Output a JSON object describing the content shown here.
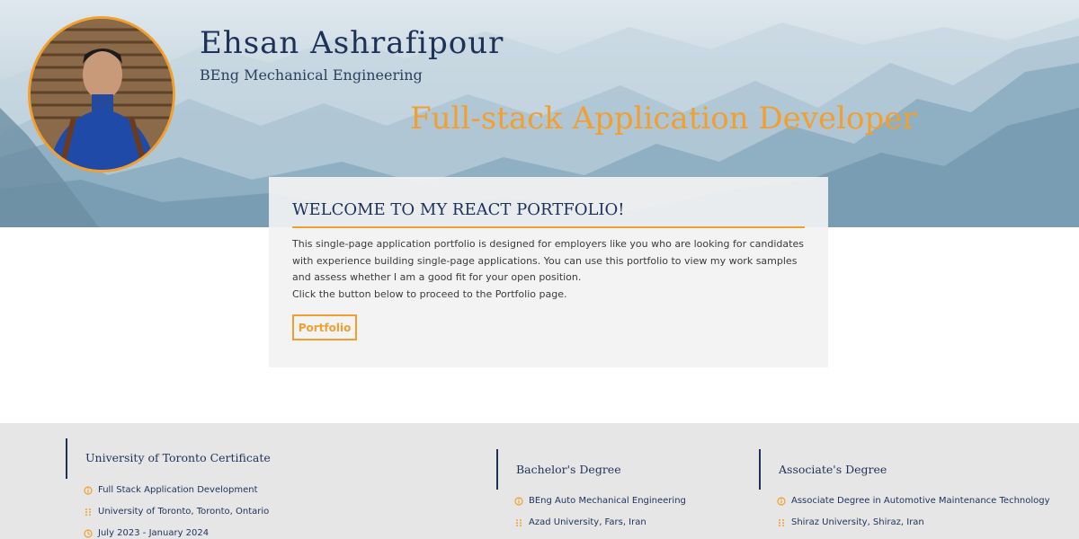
{
  "header": {
    "name": "Ehsan Ashrafipour",
    "degree": "BEng Mechanical Engineering",
    "role": "Full-stack Application Developer"
  },
  "welcome": {
    "title": "WELCOME TO MY REACT PORTFOLIO!",
    "paragraph1": "This single-page application portfolio is designed for employers like you who are looking for candidates with experience building single-page applications. You can use this portfolio to view my work samples and assess whether I am a good fit for your open position.",
    "paragraph2": "Click the button below to proceed to the Portfolio page.",
    "button_label": "Portfolio"
  },
  "education": [
    {
      "title": "University of Toronto Certificate",
      "items": [
        {
          "icon": "info-circle-icon",
          "text": "Full Stack Application Development"
        },
        {
          "icon": "location-dots-icon",
          "text": "University of Toronto, Toronto, Ontario"
        },
        {
          "icon": "clock-icon",
          "text": "July 2023 - January 2024"
        }
      ]
    },
    {
      "title": "Bachelor's Degree",
      "items": [
        {
          "icon": "info-circle-icon",
          "text": "BEng Auto Mechanical Engineering"
        },
        {
          "icon": "location-dots-icon",
          "text": "Azad University, Fars, Iran"
        }
      ]
    },
    {
      "title": "Associate's Degree",
      "items": [
        {
          "icon": "info-circle-icon",
          "text": "Associate Degree in Automotive Maintenance Technology"
        },
        {
          "icon": "location-dots-icon",
          "text": "Shiraz University, Shiraz, Iran"
        }
      ]
    }
  ],
  "colors": {
    "accent": "#f0a030",
    "navy": "#1e3258",
    "card_bg": "#f2f2f2",
    "section_bg": "#e6e6e6"
  }
}
